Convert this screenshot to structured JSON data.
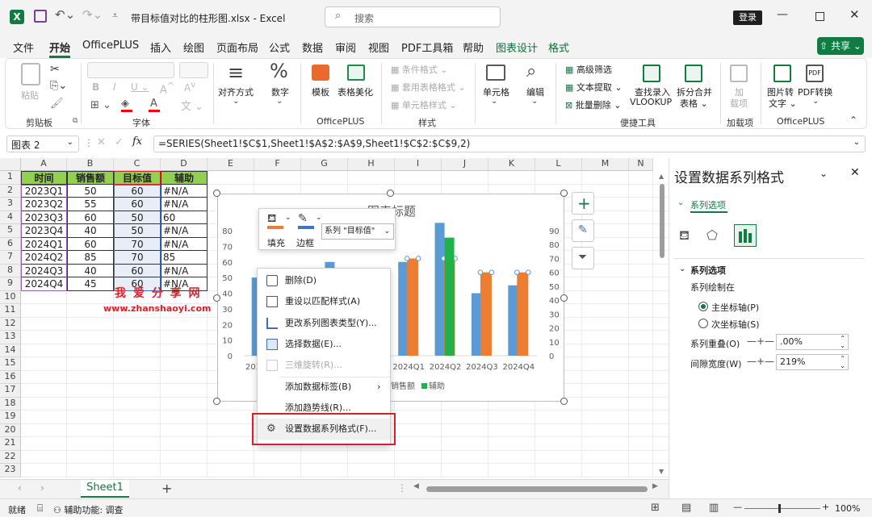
{
  "titlebar": {
    "autosave_hint": "",
    "filename": "带目标值对比的柱形图.xlsx",
    "separator": "-",
    "app": "Excel",
    "search_placeholder": "搜索",
    "login": "登录"
  },
  "menu": [
    "文件",
    "开始",
    "OfficePLUS",
    "插入",
    "绘图",
    "页面布局",
    "公式",
    "数据",
    "审阅",
    "视图",
    "PDF工具箱",
    "帮助",
    "图表设计",
    "格式"
  ],
  "share": "共享",
  "ribbon": {
    "paste": "粘贴",
    "group_clipboard": "剪贴板",
    "group_font": "字体",
    "align": "对齐方式",
    "number": "数字",
    "template": "模板",
    "beautify": "表格美化",
    "group_officeplus": "OfficePLUS",
    "cond_format": "条件格式",
    "table_format": "套用表格格式",
    "cell_style": "单元格样式",
    "group_style": "样式",
    "cells": "单元格",
    "edit": "编辑",
    "adv_filter": "高级筛选",
    "text_extract": "文本提取",
    "batch_delete": "批量删除",
    "find_lookup_1": "查找录入",
    "find_lookup_2": "VLOOKUP",
    "split_merge_1": "拆分合并",
    "split_merge_2": "表格",
    "group_tools": "便捷工具",
    "addin_1": "加",
    "addin_2": "载项",
    "group_addin": "加载项",
    "img2txt_1": "图片转",
    "img2txt_2": "文字",
    "pdf_convert": "PDF转换",
    "group_officeplus2": "OfficePLUS"
  },
  "formula_bar": {
    "name_box": "图表 2",
    "fx": "fx",
    "formula": "=SERIES(Sheet1!$C$1,Sheet1!$A$2:$A$9,Sheet1!$C$2:$C$9,2)"
  },
  "columns": [
    "A",
    "B",
    "C",
    "D",
    "E",
    "F",
    "G",
    "H",
    "I",
    "J",
    "K",
    "L",
    "M",
    "N"
  ],
  "rows": [
    "1",
    "2",
    "3",
    "4",
    "5",
    "6",
    "7",
    "8",
    "9",
    "10",
    "11",
    "12",
    "13",
    "14",
    "15",
    "16",
    "17",
    "18",
    "19",
    "20",
    "21",
    "22",
    "23"
  ],
  "table": {
    "headers": [
      "时间",
      "销售额",
      "目标值",
      "辅助"
    ],
    "data": [
      [
        "2023Q1",
        "50",
        "60",
        "#N/A"
      ],
      [
        "2023Q2",
        "55",
        "60",
        "#N/A"
      ],
      [
        "2023Q3",
        "60",
        "50",
        "60"
      ],
      [
        "2023Q4",
        "40",
        "50",
        "#N/A"
      ],
      [
        "2024Q1",
        "60",
        "70",
        "#N/A"
      ],
      [
        "2024Q2",
        "85",
        "70",
        "85"
      ],
      [
        "2024Q3",
        "40",
        "60",
        "#N/A"
      ],
      [
        "2024Q4",
        "45",
        "60",
        "#N/A"
      ]
    ]
  },
  "watermark": {
    "title": "我 爱 分 享 网",
    "url": "www.zhanshaoyi.com"
  },
  "chart_data": {
    "type": "bar",
    "title": "图表标题",
    "categories": [
      "2023Q1",
      "2023Q2",
      "2023Q3",
      "2023Q4",
      "2024Q1",
      "2024Q2",
      "2024Q3",
      "2024Q4"
    ],
    "series": [
      {
        "name": "销售额",
        "values": [
          50,
          55,
          60,
          40,
          60,
          85,
          40,
          45
        ],
        "color": "#5b9bd5"
      },
      {
        "name": "目标值",
        "values": [
          60,
          60,
          50,
          50,
          70,
          70,
          60,
          60
        ],
        "color": "#ed7d31"
      },
      {
        "name": "辅助",
        "values": [
          null,
          null,
          60,
          null,
          null,
          85,
          null,
          null
        ],
        "color": "#21b14b"
      }
    ],
    "primary_axis_ticks": [
      "0",
      "10",
      "20",
      "30",
      "40",
      "50",
      "60",
      "70",
      "80"
    ],
    "secondary_axis_ticks": [
      "0",
      "10",
      "20",
      "30",
      "40",
      "50",
      "60",
      "70",
      "80",
      "90"
    ],
    "ylim": [
      0,
      80
    ],
    "y2lim": [
      0,
      90
    ],
    "legend": "bottom",
    "visible_category_labels": [
      "2024Q1",
      "2024Q2",
      "2024Q3",
      "2024Q4"
    ],
    "visible_partial_label": "2023",
    "legend_visible": [
      "销售额",
      "辅助"
    ]
  },
  "minitoolbar": {
    "fill": "填充",
    "border": "边框",
    "series_select": "系列 \"目标值\""
  },
  "context_menu": [
    {
      "label": "删除(D)",
      "icon": "delete-icon",
      "enabled": true
    },
    {
      "label": "重设以匹配样式(A)",
      "icon": "reset-style-icon",
      "enabled": true
    },
    {
      "label": "更改系列图表类型(Y)...",
      "icon": "chart-type-icon",
      "enabled": true
    },
    {
      "label": "选择数据(E)...",
      "icon": "select-data-icon",
      "enabled": true
    },
    {
      "label": "三维旋转(R)...",
      "icon": "rotate-3d-icon",
      "enabled": false
    },
    {
      "label": "添加数据标签(B)",
      "icon": "",
      "enabled": true
    },
    {
      "label": "添加趋势线(R)...",
      "icon": "",
      "enabled": true
    },
    {
      "label": "设置数据系列格式(F)...",
      "icon": "format-series-icon",
      "enabled": true
    }
  ],
  "pane": {
    "title": "设置数据系列格式",
    "tab": "系列选项",
    "section": "系列选项",
    "plot_on": "系列绘制在",
    "primary_axis": "主坐标轴(P)",
    "secondary_axis": "次坐标轴(S)",
    "overlap_label": "系列重叠(O)",
    "overlap_value": ".00%",
    "gap_label": "间隙宽度(W)",
    "gap_value": "219%"
  },
  "sheet_tab": "Sheet1",
  "status": {
    "ready": "就绪",
    "accessibility": "辅助功能: 调查",
    "zoom": "100%"
  },
  "colors": {
    "excel_green": "#107c41",
    "highlight_red": "#d9202a",
    "header_fill": "#92d050"
  }
}
